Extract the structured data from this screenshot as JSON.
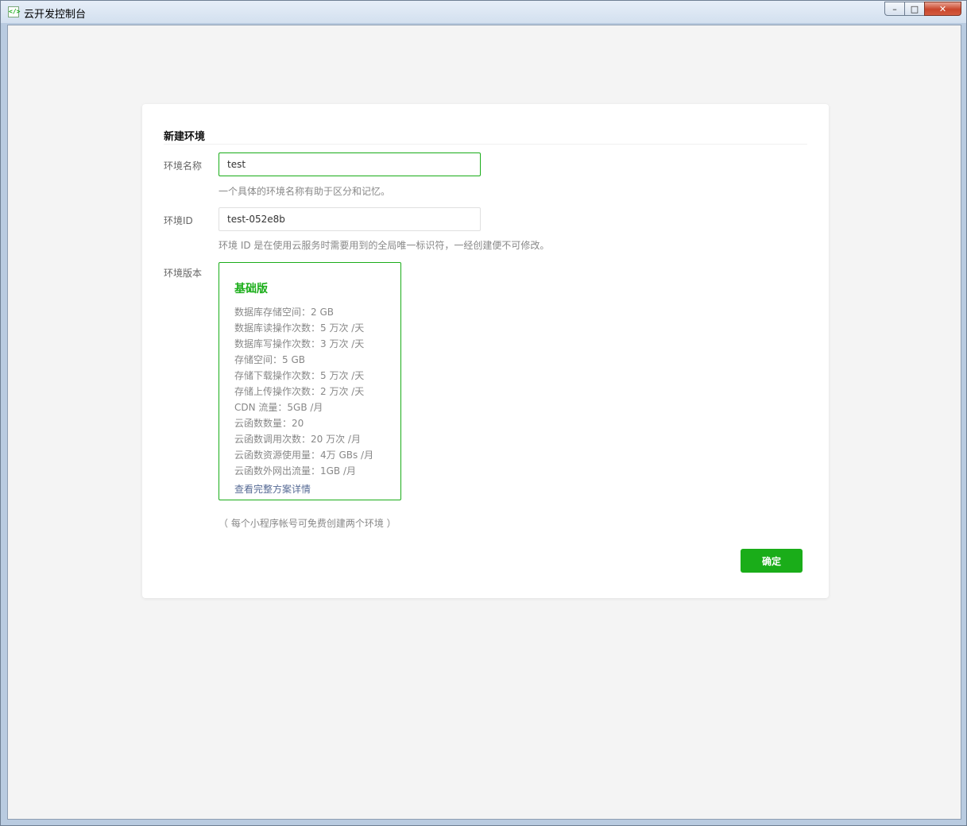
{
  "window": {
    "title": "云开发控制台",
    "icon": "code-brackets-icon",
    "controls": {
      "minimize": "–",
      "maximize": "□",
      "close": "✕"
    }
  },
  "form": {
    "title": "新建环境",
    "env_name": {
      "label": "环境名称",
      "value": "test",
      "hint": "一个具体的环境名称有助于区分和记忆。"
    },
    "env_id": {
      "label": "环境ID",
      "value": "test-052e8b",
      "hint": "环境 ID 是在使用云服务时需要用到的全局唯一标识符，一经创建便不可修改。"
    },
    "env_version": {
      "label": "环境版本",
      "plan": {
        "name": "基础版",
        "features": [
          "数据库存储空间：2 GB",
          "数据库读操作次数：5 万次 /天",
          "数据库写操作次数：3 万次 /天",
          "存储空间：5 GB",
          "存储下载操作次数：5 万次 /天",
          "存储上传操作次数：2 万次 /天",
          "CDN 流量：5GB /月",
          "云函数数量：20",
          "云函数调用次数：20 万次 /月",
          "云函数资源使用量：4万 GBs /月",
          "云函数外网出流量：1GB /月"
        ],
        "details_link": "查看完整方案详情"
      }
    },
    "note": "（ 每个小程序帐号可免费创建两个环境 ）",
    "confirm_label": "确定"
  },
  "colors": {
    "accent": "#1aad19",
    "link": "#576b95"
  }
}
